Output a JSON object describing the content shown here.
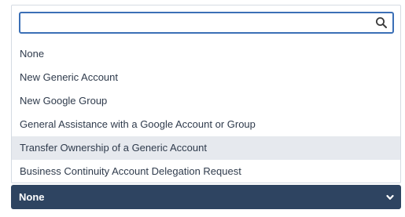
{
  "search": {
    "value": "",
    "placeholder": ""
  },
  "options": [
    {
      "label": "None"
    },
    {
      "label": "New Generic Account"
    },
    {
      "label": "New Google Group"
    },
    {
      "label": "General Assistance with a Google Account or Group"
    },
    {
      "label": "Transfer Ownership of a Generic Account"
    },
    {
      "label": "Business Continuity Account Delegation Request"
    }
  ],
  "highlighted_index": 4,
  "select": {
    "value": "None"
  },
  "icons": {
    "search": "search-icon",
    "chevron": "chevron-down-icon"
  },
  "colors": {
    "search_border": "#3b6fb6",
    "highlight_bg": "#e6e9ee",
    "select_bg": "#2e4461",
    "option_text": "#2f3b4c"
  }
}
